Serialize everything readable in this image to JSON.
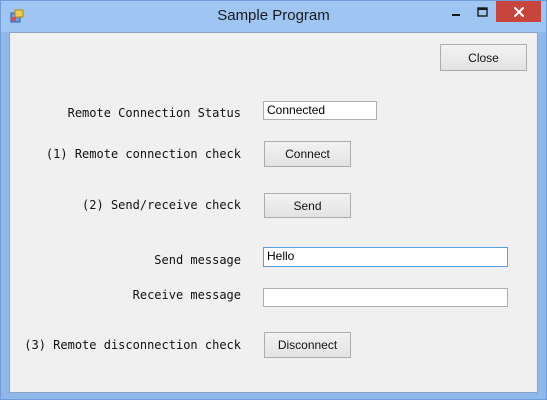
{
  "window": {
    "title": "Sample Program",
    "icon": "app-icon"
  },
  "close_button": "Close",
  "status": {
    "label": "Remote Connection Status",
    "value": "Connected"
  },
  "step1": {
    "label": "(1) Remote connection check",
    "button": "Connect"
  },
  "step2": {
    "label": "(2) Send/receive check",
    "button": "Send"
  },
  "send_message": {
    "label": "Send message",
    "value": "Hello"
  },
  "receive_message": {
    "label": "Receive message",
    "value": ""
  },
  "step3": {
    "label": "(3) Remote disconnection check",
    "button": "Disconnect"
  },
  "colors": {
    "titlebar": "#9fc6f2",
    "close_control": "#c7453c",
    "client_bg": "#f0f0f0"
  }
}
